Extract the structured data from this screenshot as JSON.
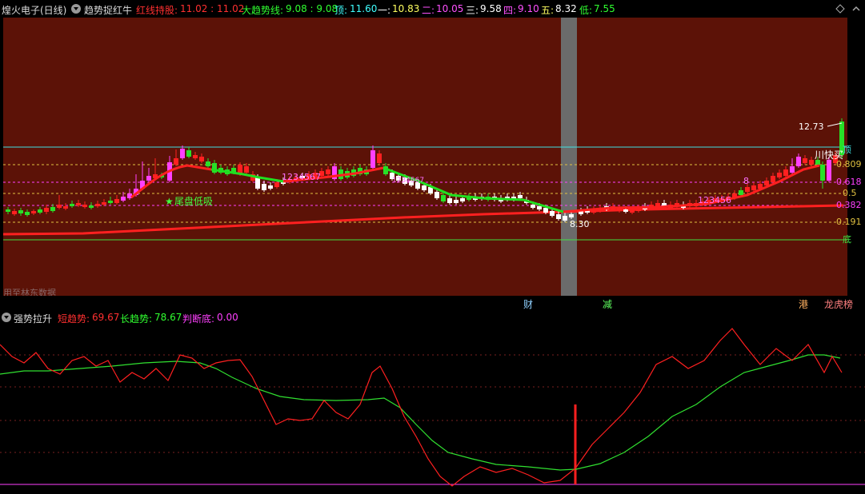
{
  "main_header": {
    "title": "煌火电子(日线)",
    "indicator_name": "趋势捉红牛",
    "hold_label": "红线持股:",
    "hold_value": "11.02 : 11.02",
    "trend_label": "大趋势线:",
    "trend_value": "9.08 : 9.08",
    "top_label": "顶:",
    "top_value": "11.60",
    "l1_label": "一:",
    "l1_value": "10.83",
    "l2_label": "二:",
    "l2_value": "10.05",
    "l3_label": "三:",
    "l3_value": "9.58",
    "l4_label": "四:",
    "l4_value": "9.10",
    "l5_label": "五:",
    "l5_value": "8.32",
    "low_label": "低:",
    "low_value": "7.55"
  },
  "right_axis": {
    "top": "顶",
    "r809": "0.809",
    "r618": "0.618",
    "r5": "0.5",
    "r382": "0.382",
    "r191": "0.191",
    "bottom": "底"
  },
  "annotations": {
    "high_price": "12.73",
    "low_price": "8.30",
    "tail_buy": "尾盘低吸",
    "jump": "川快买",
    "seq1": "1234567",
    "seq2": "123456",
    "seq3": "1234567",
    "seq_tail": "8",
    "watermark": "用至林东数据"
  },
  "badges": {
    "cai": "财",
    "jian": "减",
    "gang": "港",
    "long": "龙虎",
    "bang": "榜"
  },
  "sub_header": {
    "name": "强势拉升",
    "short_label": "短趋势:",
    "short_value": "69.67",
    "long_label": "长趋势:",
    "long_value": "78.67",
    "judge_label": "判断底:",
    "judge_value": "0.00"
  },
  "colors": {
    "up": "#ff2020",
    "down": "#28e028",
    "panel_bg": "#5c1207",
    "pink": "#ff40ff",
    "cyan": "#00ffff"
  },
  "icons": [
    "dropdown-icon",
    "diamond-icon",
    "star-icon"
  ]
}
